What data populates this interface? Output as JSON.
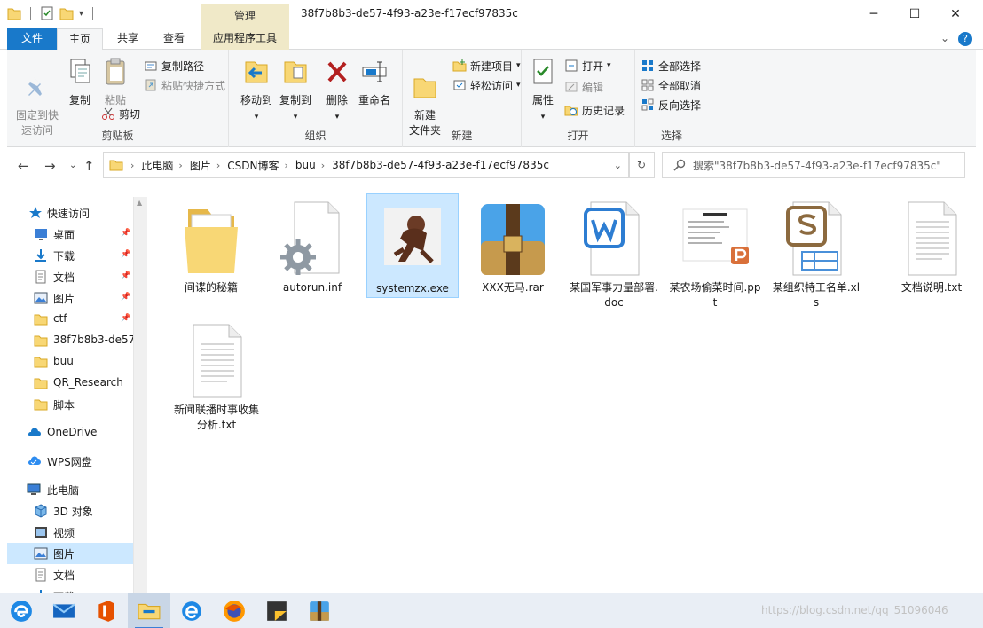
{
  "window": {
    "title": "38f7b8b3-de57-4f93-a23e-f17ecf97835c",
    "manage_label": "管理",
    "minimize": "─",
    "maximize": "☐",
    "close": "✕"
  },
  "ribbon_tabs": {
    "file": "文件",
    "home": "主页",
    "share": "共享",
    "view": "查看",
    "app_tools": "应用程序工具",
    "collapse": "⌄",
    "help": "?"
  },
  "ribbon": {
    "clipboard": {
      "group": "剪贴板",
      "pin": "固定到快\n速访问",
      "copy": "复制",
      "paste": "粘贴",
      "copy_path": "复制路径",
      "paste_shortcut": "粘贴快捷方式",
      "cut": "剪切"
    },
    "organize": {
      "group": "组织",
      "move_to": "移动到",
      "copy_to": "复制到",
      "delete": "删除",
      "rename": "重命名"
    },
    "new": {
      "group": "新建",
      "new_folder": "新建\n文件夹",
      "new_item": "新建项目",
      "easy_access": "轻松访问"
    },
    "open": {
      "group": "打开",
      "properties": "属性",
      "open": "打开",
      "edit": "编辑",
      "history": "历史记录"
    },
    "select": {
      "group": "选择",
      "select_all": "全部选择",
      "select_none": "全部取消",
      "invert": "反向选择"
    }
  },
  "address": {
    "crumbs": [
      "此电脑",
      "图片",
      "CSDN博客",
      "buu",
      "38f7b8b3-de57-4f93-a23e-f17ecf97835c"
    ],
    "search_placeholder": "搜索\"38f7b8b3-de57-4f93-a23e-f17ecf97835c\""
  },
  "nav": [
    {
      "label": "快速访问",
      "icon": "star-icon"
    },
    {
      "label": "桌面",
      "icon": "desktop-icon",
      "pinned": true
    },
    {
      "label": "下载",
      "icon": "download-icon",
      "pinned": true
    },
    {
      "label": "文档",
      "icon": "document-icon",
      "pinned": true
    },
    {
      "label": "图片",
      "icon": "pictures-icon",
      "pinned": true
    },
    {
      "label": "ctf",
      "icon": "folder-icon",
      "pinned": true
    },
    {
      "label": "38f7b8b3-de57",
      "icon": "folder-icon"
    },
    {
      "label": "buu",
      "icon": "folder-icon"
    },
    {
      "label": "QR_Research",
      "icon": "folder-icon"
    },
    {
      "label": "脚本",
      "icon": "folder-icon"
    },
    {
      "label": "OneDrive",
      "icon": "cloud-icon"
    },
    {
      "label": "WPS网盘",
      "icon": "wps-cloud-icon"
    },
    {
      "label": "此电脑",
      "icon": "pc-icon"
    },
    {
      "label": "3D 对象",
      "icon": "3d-icon"
    },
    {
      "label": "视频",
      "icon": "video-icon"
    },
    {
      "label": "图片",
      "icon": "pictures-icon"
    },
    {
      "label": "文档",
      "icon": "document-icon"
    },
    {
      "label": "下载",
      "icon": "download-icon"
    }
  ],
  "files": [
    {
      "name": "间谍的秘籍",
      "icon": "folder-icon"
    },
    {
      "name": "autorun.inf",
      "icon": "settings-file-icon"
    },
    {
      "name": "systemzx.exe",
      "icon": "exe-thief-icon"
    },
    {
      "name": "XXX无马.rar",
      "icon": "winrar-icon"
    },
    {
      "name": "某国军事力量部署.doc",
      "icon": "wps-writer-icon"
    },
    {
      "name": "某农场偷菜时间.ppt",
      "icon": "wps-presentation-icon"
    },
    {
      "name": "某组织特工名单.xls",
      "icon": "wps-spreadsheet-icon"
    },
    {
      "name": "文档说明.txt",
      "icon": "text-file-icon"
    },
    {
      "name": "新闻联播时事收集分析.txt",
      "icon": "text-file-icon"
    }
  ],
  "taskbar": {
    "apps": [
      "edge-icon",
      "mail-icon",
      "office-icon",
      "explorer-icon",
      "ie-icon",
      "firefox-icon",
      "sticky-notes-icon",
      "winrar-icon"
    ],
    "watermark": "https://blog.csdn.net/qq_51096046"
  },
  "colors": {
    "accent": "#1979ca",
    "selection": "#cce8ff",
    "tools_tab": "#f0e9c8",
    "folder": "#f8d775"
  }
}
